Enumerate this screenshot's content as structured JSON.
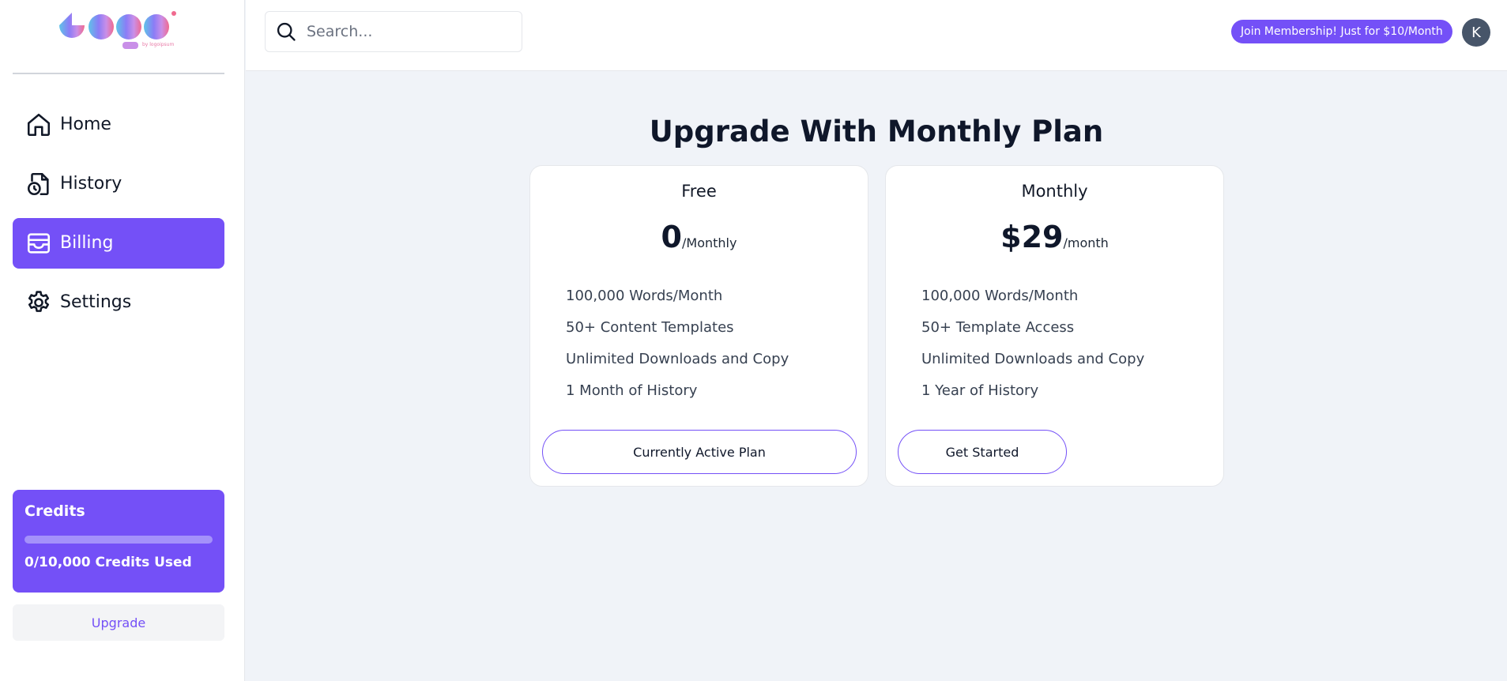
{
  "sidebar": {
    "logo_text": "Logo",
    "logo_subtext": "by logoipsum",
    "nav_items": [
      {
        "label": "Home",
        "icon": "home-icon"
      },
      {
        "label": "History",
        "icon": "history-file-icon"
      },
      {
        "label": "Billing",
        "icon": "wallet-icon",
        "active": true
      },
      {
        "label": "Settings",
        "icon": "gear-icon"
      }
    ],
    "credits": {
      "title": "Credits",
      "used_text": "0/10,000 Credits Used",
      "used": 0,
      "total": 10000
    },
    "upgrade_label": "Upgrade"
  },
  "header": {
    "search_placeholder": "Search...",
    "membership_badge": "Join Membership! Just for $10/Month",
    "avatar_initial": "K"
  },
  "main": {
    "title": "Upgrade With Monthly Plan",
    "plans": [
      {
        "name": "Free",
        "price": "0",
        "period": "/Monthly",
        "features": [
          "100,000 Words/Month",
          "50+ Content Templates",
          "Unlimited Downloads and Copy",
          "1 Month of History"
        ],
        "button_label": "Currently Active Plan"
      },
      {
        "name": "Monthly",
        "price": "$29",
        "period": "/month",
        "features": [
          "100,000 Words/Month",
          "50+ Template Access",
          "Unlimited Downloads and Copy",
          "1 Year of History"
        ],
        "button_label": "Get Started"
      }
    ]
  },
  "colors": {
    "accent": "#7450f7",
    "background": "#f0f3f8",
    "avatar": "#475569"
  }
}
